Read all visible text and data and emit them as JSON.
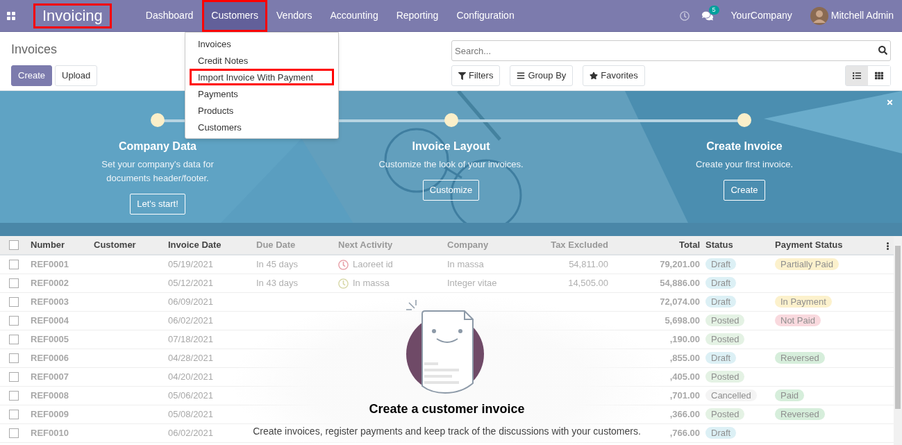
{
  "navbar": {
    "app_name": {
      "text": "Invoicing",
      "highlighted": true
    },
    "menu": [
      {
        "label": "Dashboard",
        "selected": false,
        "highlighted": false
      },
      {
        "label": "Customers",
        "selected": true,
        "highlighted": true
      },
      {
        "label": "Vendors",
        "selected": false,
        "highlighted": false
      },
      {
        "label": "Accounting",
        "selected": false,
        "highlighted": false
      },
      {
        "label": "Reporting",
        "selected": false,
        "highlighted": false
      },
      {
        "label": "Configuration",
        "selected": false,
        "highlighted": false
      }
    ],
    "chat_badge": "5",
    "company": "YourCompany",
    "user": "Mitchell Admin"
  },
  "dropdown": {
    "items": [
      {
        "label": "Invoices",
        "highlighted": false
      },
      {
        "label": "Credit Notes",
        "highlighted": false
      },
      {
        "label": "Import Invoice With Payment",
        "highlighted": true
      },
      {
        "label": "Payments",
        "highlighted": false
      },
      {
        "label": "Products",
        "highlighted": false
      },
      {
        "label": "Customers",
        "highlighted": false
      }
    ]
  },
  "control_panel": {
    "title": "Invoices",
    "buttons": [
      {
        "label": "Create",
        "kind": "primary"
      },
      {
        "label": "Upload",
        "kind": "secondary"
      }
    ],
    "search": {
      "placeholder": "Search..."
    },
    "filters": [
      {
        "label": "Filters",
        "kind": "filter"
      },
      {
        "label": "Group By",
        "kind": "group"
      },
      {
        "label": "Favorites",
        "kind": "star"
      }
    ],
    "views": [
      {
        "kind": "list",
        "selected": true
      },
      {
        "kind": "kanban",
        "selected": false
      }
    ]
  },
  "banner": {
    "steps": [
      {
        "title": "Company Data",
        "description": "Set your company's data for documents header/footer.",
        "button": "Let's start!"
      },
      {
        "title": "Invoice Layout",
        "description": "Customize the look of your invoices.",
        "button": "Customize"
      },
      {
        "title": "Create Invoice",
        "description": "Create your first invoice.",
        "button": "Create"
      }
    ]
  },
  "table": {
    "select_all": {
      "checked": false
    },
    "columns": [
      "Number",
      "Customer",
      "Invoice Date",
      "Due Date",
      "Next Activity",
      "Company",
      "Tax Excluded",
      "Total",
      "Status",
      "Payment Status"
    ],
    "rows": [
      {
        "checked": false,
        "number": "REF0001",
        "invoice_date": "05/19/2021",
        "due_date": "In 45 days",
        "next_activity": {
          "text": "Laoreet id",
          "color": "#e8a0a8"
        },
        "company": "In massa",
        "tax_excluded": "54,811.00",
        "total": "79,201.00",
        "status": {
          "text": "Draft",
          "color": "#dcf0f5"
        },
        "payment_status": {
          "text": "Partially Paid",
          "color": "#fcf1cc"
        }
      },
      {
        "checked": false,
        "number": "REF0002",
        "invoice_date": "05/12/2021",
        "due_date": "In 43 days",
        "next_activity": {
          "text": "In massa",
          "color": "#d8d8a8"
        },
        "company": "Integer vitae",
        "tax_excluded": "14,505.00",
        "total": "54,886.00",
        "status": {
          "text": "Draft",
          "color": "#dcf0f5"
        }
      },
      {
        "checked": false,
        "number": "REF0003",
        "invoice_date": "06/09/2021",
        "total": "72,074.00",
        "status": {
          "text": "Draft",
          "color": "#dcf0f5"
        },
        "payment_status": {
          "text": "In Payment",
          "color": "#fcf1cc"
        }
      },
      {
        "checked": false,
        "number": "REF0004",
        "invoice_date": "06/02/2021",
        "total": "5,698.00",
        "status": {
          "text": "Posted",
          "color": "#e4f2e4"
        },
        "payment_status": {
          "text": "Not Paid",
          "color": "#f9d9de"
        }
      },
      {
        "checked": false,
        "number": "REF0005",
        "invoice_date": "07/18/2021",
        "total": ",190.00",
        "status": {
          "text": "Posted",
          "color": "#e4f2e4"
        }
      },
      {
        "checked": false,
        "number": "REF0006",
        "invoice_date": "04/28/2021",
        "total": ",855.00",
        "status": {
          "text": "Draft",
          "color": "#dcf0f5"
        },
        "payment_status": {
          "text": "Reversed",
          "color": "#d6eedb"
        }
      },
      {
        "checked": false,
        "number": "REF0007",
        "invoice_date": "04/20/2021",
        "total": ",405.00",
        "status": {
          "text": "Posted",
          "color": "#e4f2e4"
        }
      },
      {
        "checked": false,
        "number": "REF0008",
        "invoice_date": "05/06/2021",
        "total": ",701.00",
        "status": {
          "text": "Cancelled",
          "color": "#f4f4f4"
        },
        "payment_status": {
          "text": "Paid",
          "color": "#d6eedb"
        }
      },
      {
        "checked": false,
        "number": "REF0009",
        "invoice_date": "05/08/2021",
        "total": ",366.00",
        "status": {
          "text": "Posted",
          "color": "#e4f2e4"
        },
        "payment_status": {
          "text": "Reversed",
          "color": "#d6eedb"
        }
      },
      {
        "checked": false,
        "number": "REF0010",
        "invoice_date": "06/02/2021",
        "total": ",766.00",
        "status": {
          "text": "Draft",
          "color": "#dcf0f5"
        }
      }
    ]
  },
  "empty_state": {
    "title": "Create a customer invoice",
    "text": "Create invoices, register payments and keep track of the discussions with your customers."
  }
}
